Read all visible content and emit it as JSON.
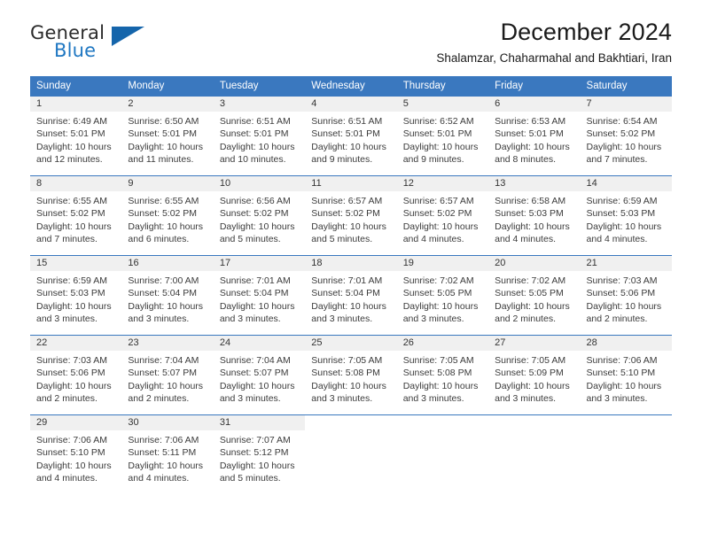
{
  "brand": {
    "name_part1": "General",
    "name_part2": "Blue",
    "triangle_color": "#1565ab",
    "blue_color": "#1f77c2"
  },
  "header": {
    "title": "December 2024",
    "subtitle": "Shalamzar, Chaharmahal and Bakhtiari, Iran"
  },
  "theme": {
    "header_bg": "#3a78bf",
    "daynum_bg": "#f0f0f0",
    "cell_bg": "#ffffff",
    "text_color": "#3b3b3b"
  },
  "weekdays": [
    "Sunday",
    "Monday",
    "Tuesday",
    "Wednesday",
    "Thursday",
    "Friday",
    "Saturday"
  ],
  "labels": {
    "sunrise_prefix": "Sunrise:",
    "sunset_prefix": "Sunset:",
    "daylight_prefix": "Daylight:"
  },
  "weeks": [
    [
      {
        "day": "1",
        "sunrise": "Sunrise: 6:49 AM",
        "sunset": "Sunset: 5:01 PM",
        "daylight": "Daylight: 10 hours and 12 minutes."
      },
      {
        "day": "2",
        "sunrise": "Sunrise: 6:50 AM",
        "sunset": "Sunset: 5:01 PM",
        "daylight": "Daylight: 10 hours and 11 minutes."
      },
      {
        "day": "3",
        "sunrise": "Sunrise: 6:51 AM",
        "sunset": "Sunset: 5:01 PM",
        "daylight": "Daylight: 10 hours and 10 minutes."
      },
      {
        "day": "4",
        "sunrise": "Sunrise: 6:51 AM",
        "sunset": "Sunset: 5:01 PM",
        "daylight": "Daylight: 10 hours and 9 minutes."
      },
      {
        "day": "5",
        "sunrise": "Sunrise: 6:52 AM",
        "sunset": "Sunset: 5:01 PM",
        "daylight": "Daylight: 10 hours and 9 minutes."
      },
      {
        "day": "6",
        "sunrise": "Sunrise: 6:53 AM",
        "sunset": "Sunset: 5:01 PM",
        "daylight": "Daylight: 10 hours and 8 minutes."
      },
      {
        "day": "7",
        "sunrise": "Sunrise: 6:54 AM",
        "sunset": "Sunset: 5:02 PM",
        "daylight": "Daylight: 10 hours and 7 minutes."
      }
    ],
    [
      {
        "day": "8",
        "sunrise": "Sunrise: 6:55 AM",
        "sunset": "Sunset: 5:02 PM",
        "daylight": "Daylight: 10 hours and 7 minutes."
      },
      {
        "day": "9",
        "sunrise": "Sunrise: 6:55 AM",
        "sunset": "Sunset: 5:02 PM",
        "daylight": "Daylight: 10 hours and 6 minutes."
      },
      {
        "day": "10",
        "sunrise": "Sunrise: 6:56 AM",
        "sunset": "Sunset: 5:02 PM",
        "daylight": "Daylight: 10 hours and 5 minutes."
      },
      {
        "day": "11",
        "sunrise": "Sunrise: 6:57 AM",
        "sunset": "Sunset: 5:02 PM",
        "daylight": "Daylight: 10 hours and 5 minutes."
      },
      {
        "day": "12",
        "sunrise": "Sunrise: 6:57 AM",
        "sunset": "Sunset: 5:02 PM",
        "daylight": "Daylight: 10 hours and 4 minutes."
      },
      {
        "day": "13",
        "sunrise": "Sunrise: 6:58 AM",
        "sunset": "Sunset: 5:03 PM",
        "daylight": "Daylight: 10 hours and 4 minutes."
      },
      {
        "day": "14",
        "sunrise": "Sunrise: 6:59 AM",
        "sunset": "Sunset: 5:03 PM",
        "daylight": "Daylight: 10 hours and 4 minutes."
      }
    ],
    [
      {
        "day": "15",
        "sunrise": "Sunrise: 6:59 AM",
        "sunset": "Sunset: 5:03 PM",
        "daylight": "Daylight: 10 hours and 3 minutes."
      },
      {
        "day": "16",
        "sunrise": "Sunrise: 7:00 AM",
        "sunset": "Sunset: 5:04 PM",
        "daylight": "Daylight: 10 hours and 3 minutes."
      },
      {
        "day": "17",
        "sunrise": "Sunrise: 7:01 AM",
        "sunset": "Sunset: 5:04 PM",
        "daylight": "Daylight: 10 hours and 3 minutes."
      },
      {
        "day": "18",
        "sunrise": "Sunrise: 7:01 AM",
        "sunset": "Sunset: 5:04 PM",
        "daylight": "Daylight: 10 hours and 3 minutes."
      },
      {
        "day": "19",
        "sunrise": "Sunrise: 7:02 AM",
        "sunset": "Sunset: 5:05 PM",
        "daylight": "Daylight: 10 hours and 3 minutes."
      },
      {
        "day": "20",
        "sunrise": "Sunrise: 7:02 AM",
        "sunset": "Sunset: 5:05 PM",
        "daylight": "Daylight: 10 hours and 2 minutes."
      },
      {
        "day": "21",
        "sunrise": "Sunrise: 7:03 AM",
        "sunset": "Sunset: 5:06 PM",
        "daylight": "Daylight: 10 hours and 2 minutes."
      }
    ],
    [
      {
        "day": "22",
        "sunrise": "Sunrise: 7:03 AM",
        "sunset": "Sunset: 5:06 PM",
        "daylight": "Daylight: 10 hours and 2 minutes."
      },
      {
        "day": "23",
        "sunrise": "Sunrise: 7:04 AM",
        "sunset": "Sunset: 5:07 PM",
        "daylight": "Daylight: 10 hours and 2 minutes."
      },
      {
        "day": "24",
        "sunrise": "Sunrise: 7:04 AM",
        "sunset": "Sunset: 5:07 PM",
        "daylight": "Daylight: 10 hours and 3 minutes."
      },
      {
        "day": "25",
        "sunrise": "Sunrise: 7:05 AM",
        "sunset": "Sunset: 5:08 PM",
        "daylight": "Daylight: 10 hours and 3 minutes."
      },
      {
        "day": "26",
        "sunrise": "Sunrise: 7:05 AM",
        "sunset": "Sunset: 5:08 PM",
        "daylight": "Daylight: 10 hours and 3 minutes."
      },
      {
        "day": "27",
        "sunrise": "Sunrise: 7:05 AM",
        "sunset": "Sunset: 5:09 PM",
        "daylight": "Daylight: 10 hours and 3 minutes."
      },
      {
        "day": "28",
        "sunrise": "Sunrise: 7:06 AM",
        "sunset": "Sunset: 5:10 PM",
        "daylight": "Daylight: 10 hours and 3 minutes."
      }
    ],
    [
      {
        "day": "29",
        "sunrise": "Sunrise: 7:06 AM",
        "sunset": "Sunset: 5:10 PM",
        "daylight": "Daylight: 10 hours and 4 minutes."
      },
      {
        "day": "30",
        "sunrise": "Sunrise: 7:06 AM",
        "sunset": "Sunset: 5:11 PM",
        "daylight": "Daylight: 10 hours and 4 minutes."
      },
      {
        "day": "31",
        "sunrise": "Sunrise: 7:07 AM",
        "sunset": "Sunset: 5:12 PM",
        "daylight": "Daylight: 10 hours and 5 minutes."
      },
      {
        "day": "",
        "sunrise": "",
        "sunset": "",
        "daylight": ""
      },
      {
        "day": "",
        "sunrise": "",
        "sunset": "",
        "daylight": ""
      },
      {
        "day": "",
        "sunrise": "",
        "sunset": "",
        "daylight": ""
      },
      {
        "day": "",
        "sunrise": "",
        "sunset": "",
        "daylight": ""
      }
    ]
  ]
}
